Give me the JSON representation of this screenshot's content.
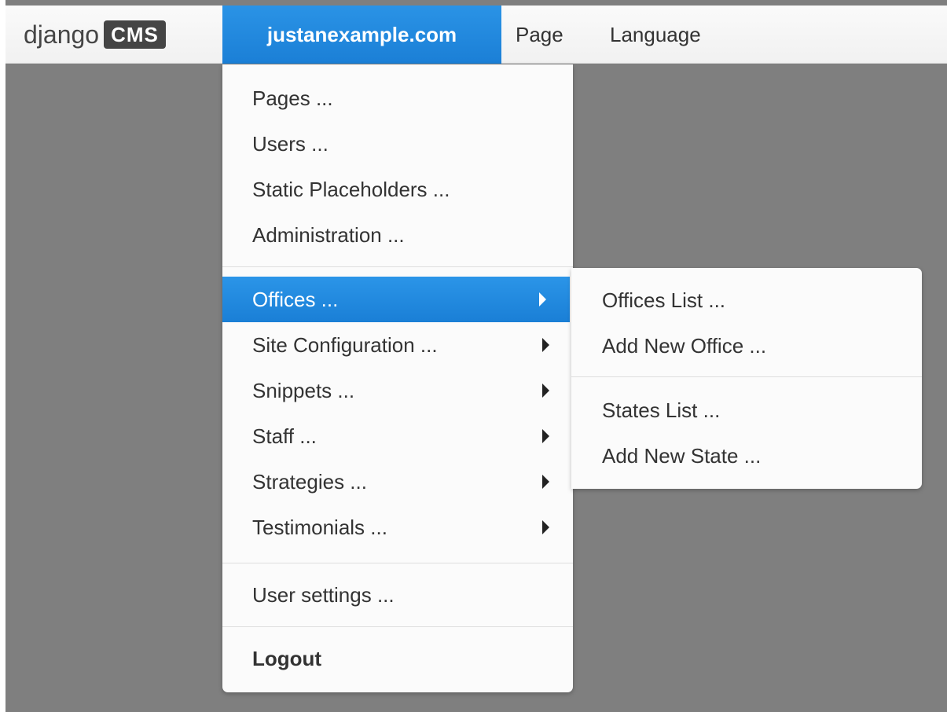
{
  "toolbar": {
    "logo_word": "django",
    "logo_badge": "CMS",
    "site": "justanexample.com",
    "page": "Page",
    "language": "Language"
  },
  "menu": {
    "items": [
      {
        "label": "Pages ..."
      },
      {
        "label": "Users ..."
      },
      {
        "label": "Static Placeholders ..."
      },
      {
        "label": "Administration ..."
      },
      {
        "label": "Offices ..."
      },
      {
        "label": "Site Configuration ..."
      },
      {
        "label": "Snippets ..."
      },
      {
        "label": "Staff ..."
      },
      {
        "label": "Strategies ..."
      },
      {
        "label": "Testimonials ..."
      },
      {
        "label": "User settings ..."
      },
      {
        "label": "Logout"
      }
    ]
  },
  "submenu": {
    "items": [
      {
        "label": "Offices List ..."
      },
      {
        "label": "Add New Office ..."
      },
      {
        "label": "States List ..."
      },
      {
        "label": "Add New State ..."
      }
    ]
  },
  "colors": {
    "accent": "#1b7fd6",
    "canvas": "#7f7f7f",
    "toolbar": "#f5f5f5",
    "menu": "#fbfbfb"
  }
}
